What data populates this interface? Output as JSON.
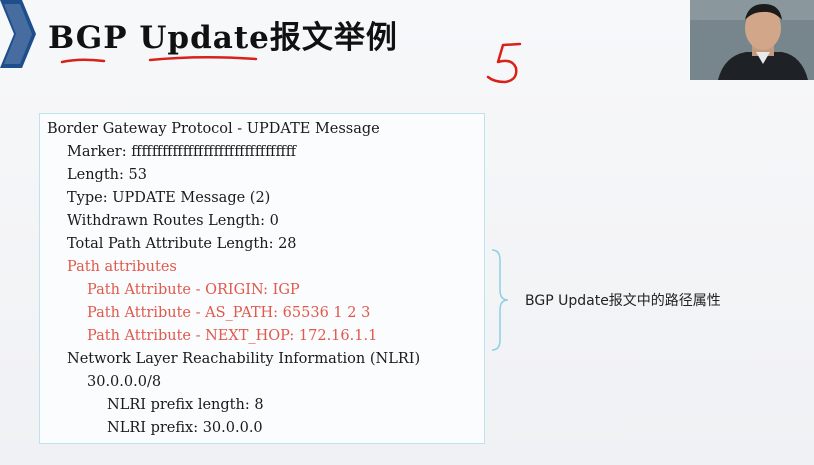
{
  "slide": {
    "title": "BGP Update报文举例"
  },
  "packet": {
    "header": "Border Gateway Protocol - UPDATE Message",
    "marker": "Marker: ffffffffffffffffffffffffffffffff",
    "length": "Length: 53",
    "type": "Type: UPDATE Message (2)",
    "withdrawn_length": "Withdrawn Routes Length: 0",
    "total_path_attr_length": "Total Path Attribute Length: 28",
    "path_attributes": "Path attributes",
    "attributes": [
      "Path Attribute - ORIGIN: IGP",
      "Path Attribute - AS_PATH: 65536 1 2 3",
      "Path Attribute - NEXT_HOP: 172.16.1.1"
    ],
    "nlri": "Network Layer Reachability Information (NLRI)",
    "nlri_route": "30.0.0.0/8",
    "nlri_prefix_length": "NLRI prefix length: 8",
    "nlri_prefix": "NLRI prefix: 30.0.0.0"
  },
  "side_note": "BGP Update报文中的路径属性",
  "handwriting": {
    "number": "5"
  },
  "colors": {
    "accent_red": "#e2584a",
    "ink_red": "#d8211b",
    "chevron_blue": "#1f4e8c",
    "box_border": "#bfe3ee",
    "brace_blue": "#8ed0e2"
  }
}
